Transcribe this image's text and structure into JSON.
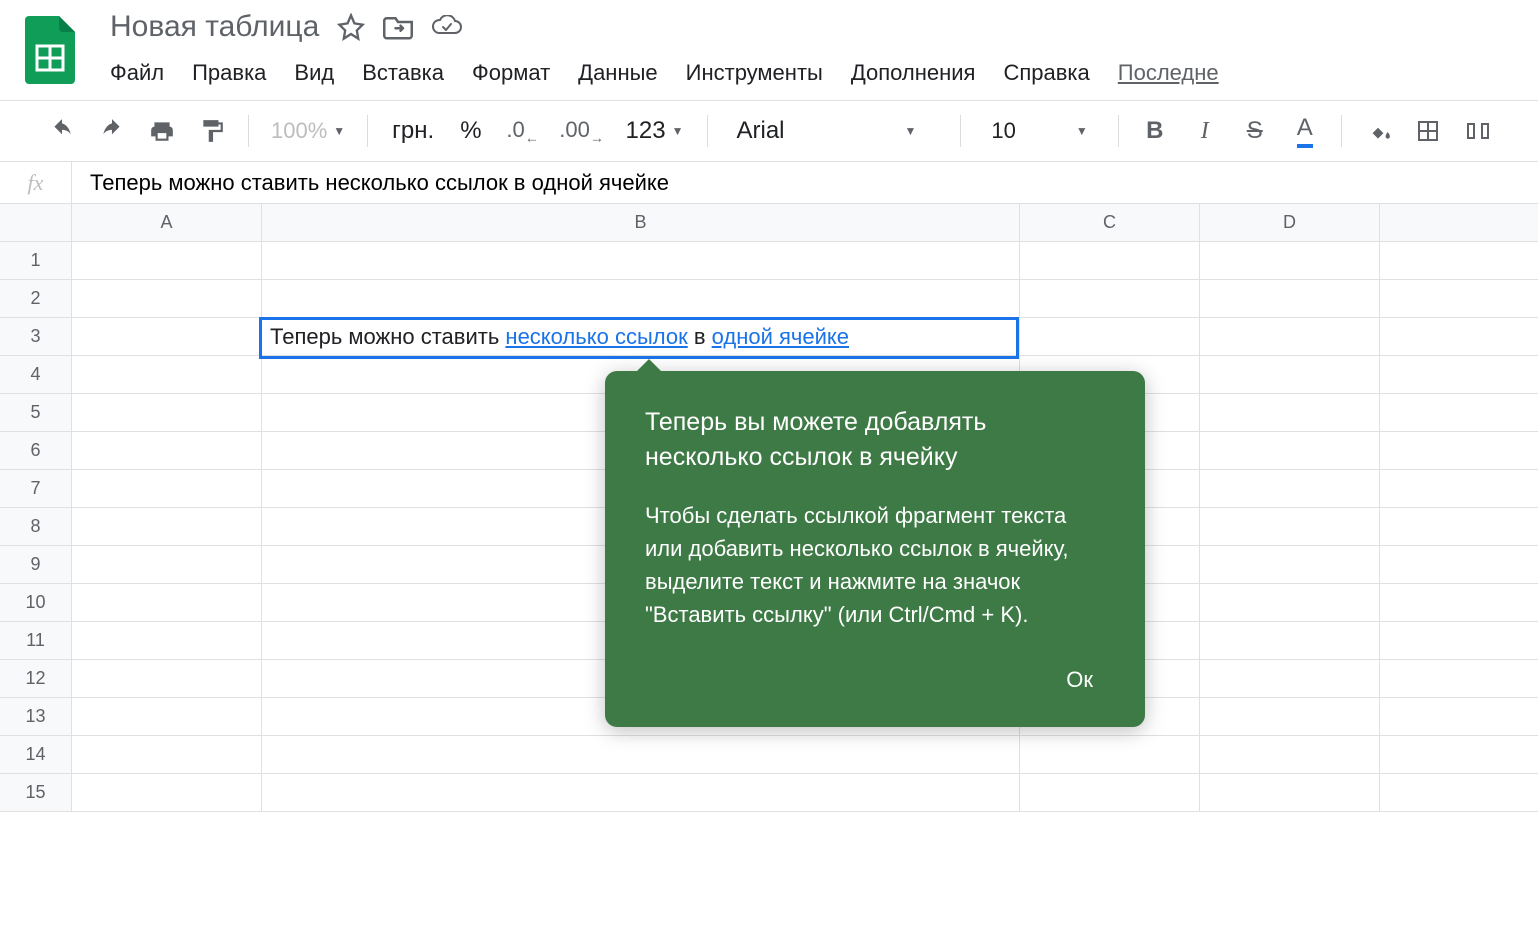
{
  "document": {
    "title": "Новая таблица"
  },
  "menu": {
    "file": "Файл",
    "edit": "Правка",
    "view": "Вид",
    "insert": "Вставка",
    "format": "Формат",
    "data": "Данные",
    "tools": "Инструменты",
    "addons": "Дополнения",
    "help": "Справка",
    "last": "Последне"
  },
  "toolbar": {
    "zoom": "100%",
    "currency": "грн.",
    "percent": "%",
    "decrease_decimal": ".0",
    "increase_decimal": ".00",
    "number_format": "123",
    "font": "Arial",
    "font_size": "10"
  },
  "formula": {
    "fx": "fx",
    "value": "Теперь можно ставить несколько ссылок в одной ячейке"
  },
  "columns": [
    "A",
    "B",
    "C",
    "D"
  ],
  "rows": [
    "1",
    "2",
    "3",
    "4",
    "5",
    "6",
    "7",
    "8",
    "9",
    "10",
    "11",
    "12",
    "13",
    "14",
    "15"
  ],
  "cell_B3": {
    "part1": "Теперь можно ставить ",
    "link1": "несколько ссылок",
    "part2": " в ",
    "link2": "одной ячейке"
  },
  "tooltip": {
    "title": "Теперь вы можете добавлять несколько ссылок в ячейку",
    "body": "Чтобы сделать ссылкой фрагмент текста или добавить несколько ссылок в ячейку, выделите текст и нажмите на значок \"Вставить ссылку\" (или Ctrl/Cmd + K).",
    "ok": "Ок"
  }
}
